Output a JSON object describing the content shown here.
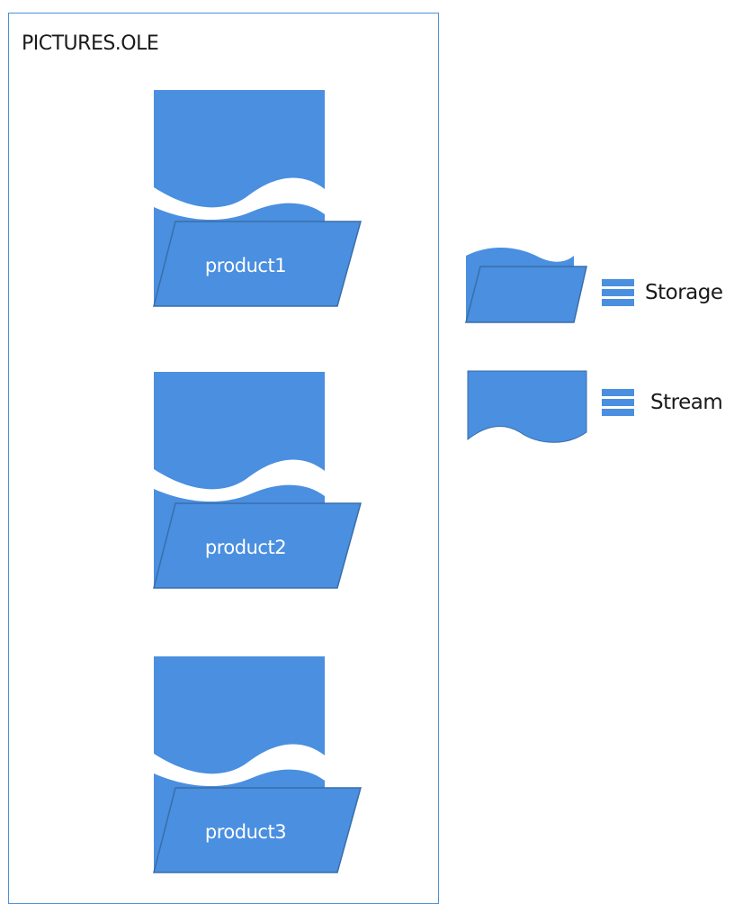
{
  "container": {
    "title": "PICTURES.OLE"
  },
  "products": [
    {
      "label": "product1"
    },
    {
      "label": "product2"
    },
    {
      "label": "product3"
    }
  ],
  "legend": {
    "storage": {
      "label": "Storage",
      "icon": "storage-icon"
    },
    "stream": {
      "label": "Stream",
      "icon": "stream-icon"
    }
  },
  "colors": {
    "fill": "#4a8fe0",
    "stroke": "#3a6ea8",
    "border": "#4a8fe0",
    "text_dark": "#1a1a1a",
    "text_light": "#ffffff"
  }
}
